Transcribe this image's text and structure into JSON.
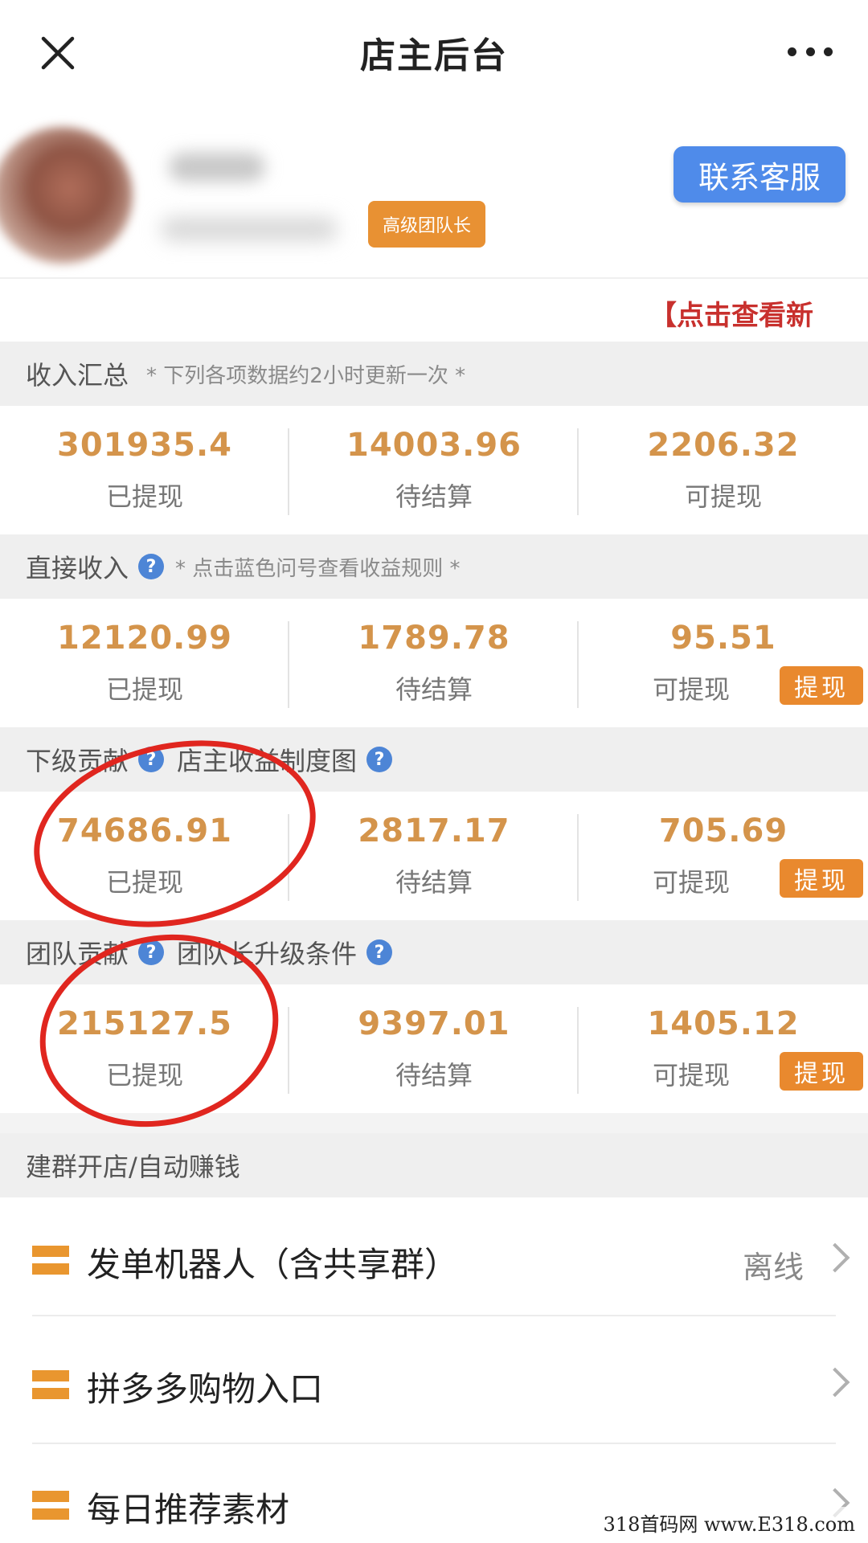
{
  "nav": {
    "title": "店主后台"
  },
  "profile": {
    "badge": "高级团队长",
    "contact_button": "联系客服",
    "notice": "【点击查看新"
  },
  "sections": [
    {
      "title": "收入汇总",
      "note": "* 下列各项数据约2小时更新一次 *",
      "stats": [
        {
          "value": "301935.4",
          "label": "已提现"
        },
        {
          "value": "14003.96",
          "label": "待结算"
        },
        {
          "value": "2206.32",
          "label": "可提现"
        }
      ]
    },
    {
      "title": "直接收入",
      "note": "* 点击蓝色问号查看收益规则 *",
      "stats": [
        {
          "value": "12120.99",
          "label": "已提现"
        },
        {
          "value": "1789.78",
          "label": "待结算"
        },
        {
          "value": "95.51",
          "label": "可提现",
          "button": "提现"
        }
      ]
    },
    {
      "title": "下级贡献",
      "link": "店主收益制度图",
      "stats": [
        {
          "value": "74686.91",
          "label": "已提现"
        },
        {
          "value": "2817.17",
          "label": "待结算"
        },
        {
          "value": "705.69",
          "label": "可提现",
          "button": "提现"
        }
      ]
    },
    {
      "title": "团队贡献",
      "link": "团队长升级条件",
      "stats": [
        {
          "value": "215127.5",
          "label": "已提现"
        },
        {
          "value": "9397.01",
          "label": "待结算"
        },
        {
          "value": "1405.12",
          "label": "可提现",
          "button": "提现"
        }
      ]
    }
  ],
  "menu": {
    "header": "建群开店/自动赚钱",
    "items": [
      {
        "label": "发单机器人（含共享群）",
        "status": "离线"
      },
      {
        "label": "拼多多购物入口"
      },
      {
        "label": "每日推荐素材"
      }
    ]
  },
  "watermark": "318首码网  www.E318.com",
  "colors": {
    "accent_orange": "#e9892e",
    "value_orange": "#d4944b",
    "contact_blue": "#4f8bea",
    "help_blue": "#4d85d6",
    "annotation_red": "#e0261f"
  },
  "icons": {
    "close": "close-icon",
    "more": "more-dots-icon",
    "help": "help-question-icon",
    "menu": "menu-bars-icon",
    "chevron": "chevron-right-icon"
  }
}
